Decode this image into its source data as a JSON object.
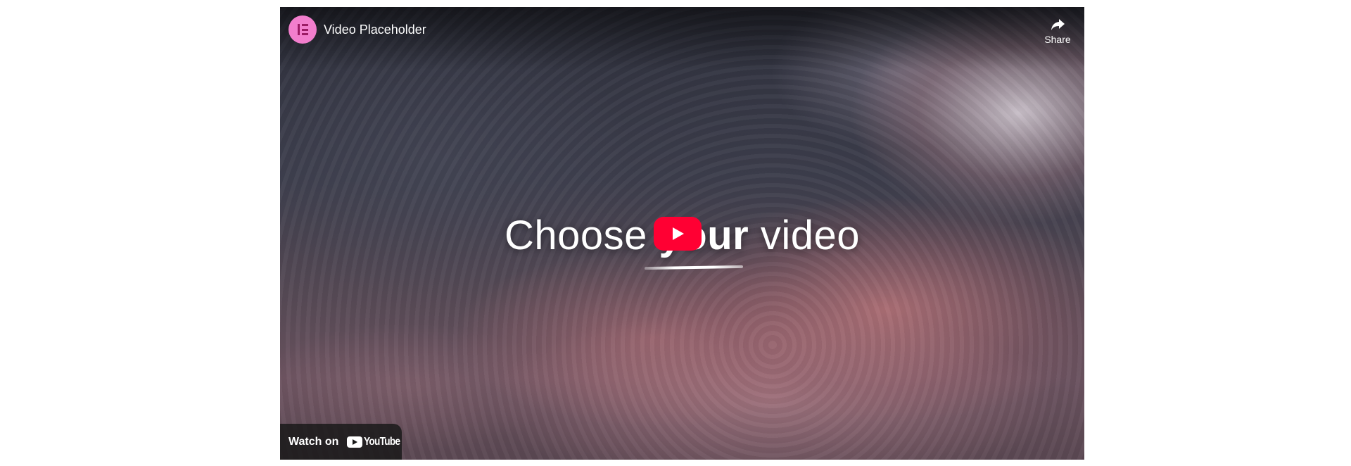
{
  "video": {
    "title": "Video Placeholder",
    "channel_icon": "elementor-logo-icon",
    "channel_icon_color": "#f27ecd"
  },
  "actions": {
    "share_label": "Share",
    "share_icon": "share-arrow-icon"
  },
  "overlay": {
    "headline_part1": "Choose ",
    "headline_part2": "your",
    "headline_part3": " video"
  },
  "play_button": {
    "icon": "youtube-play-icon",
    "color": "#ff0033"
  },
  "footer": {
    "watch_on_label": "Watch on",
    "youtube_label": "YouTube"
  }
}
